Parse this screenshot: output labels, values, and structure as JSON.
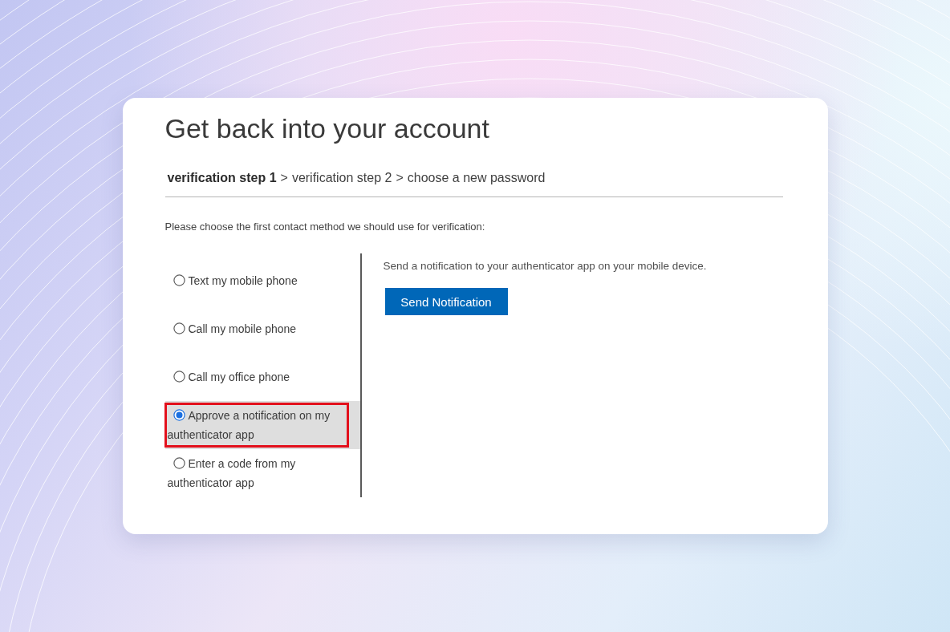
{
  "title": "Get back into your account",
  "steps": [
    {
      "label": "verification step 1",
      "current": true
    },
    {
      "label": "verification step 2",
      "current": false,
      "separator": ">"
    },
    {
      "label": "choose a new password",
      "current": false,
      "separator": ">"
    }
  ],
  "instruction": "Please choose the first contact method we should use for verification:",
  "options": [
    {
      "label": "Text my mobile phone",
      "selected": false,
      "highlighted": false
    },
    {
      "label": "Call my mobile phone",
      "selected": false,
      "highlighted": false
    },
    {
      "label": "Call my office phone",
      "selected": false,
      "highlighted": false
    },
    {
      "label": "Approve a notification on my authenticator app",
      "selected": true,
      "highlighted": true
    },
    {
      "label": "Enter a code from my authenticator app",
      "selected": false,
      "highlighted": false
    }
  ],
  "detail": {
    "text": "Send a notification to your authenticator app on your mobile device.",
    "button": "Send Notification"
  }
}
